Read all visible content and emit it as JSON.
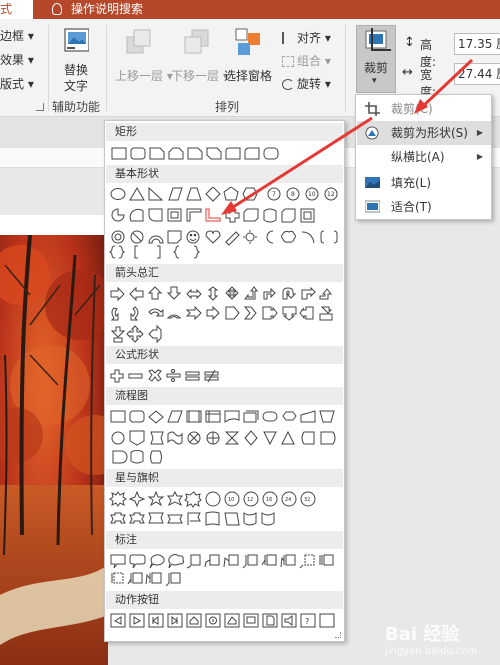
{
  "tabs": {
    "left_tab": "式",
    "search": "操作说明搜索"
  },
  "ribbon": {
    "border_label": "边框",
    "effects_label": "效果",
    "layout_label": "版式",
    "alt_text_label_1": "替换",
    "alt_text_label_2": "文字",
    "accessibility_group": "辅助功能",
    "bring_forward": "上移一层",
    "send_backward": "下移一层",
    "selection_pane": "选择窗格",
    "align": "对齐",
    "group": "组合",
    "rotate": "旋转",
    "arrange_group": "排列",
    "crop_label": "裁剪",
    "height_label": "高度:",
    "height_value": "17.35 厘",
    "width_label": "宽度:",
    "width_value": "27.44 厘"
  },
  "crop_menu": {
    "items": [
      {
        "label": "裁剪(C)",
        "icon": "crop-icon"
      },
      {
        "label": "裁剪为形状(S)",
        "icon": "crop-to-shape-icon"
      },
      {
        "label": "纵横比(A)",
        "icon": ""
      },
      {
        "label": "填充(L)",
        "icon": "fill-icon"
      },
      {
        "label": "适合(T)",
        "icon": "fit-icon"
      }
    ]
  },
  "shape_gallery": {
    "categories": [
      "矩形",
      "基本形状",
      "箭头总汇",
      "公式形状",
      "流程图",
      "星与旗帜",
      "标注",
      "动作按钮"
    ],
    "star_labels": [
      "10",
      "12",
      "16",
      "24",
      "32"
    ],
    "basic_labels": [
      "7",
      "8",
      "10",
      "12"
    ],
    "action_help": "?"
  },
  "watermark": {
    "text": "Bai 经验",
    "sub": "jingyan.baidu.com"
  },
  "colors": {
    "accent": "#b7472a",
    "arrow": "#e53935"
  }
}
